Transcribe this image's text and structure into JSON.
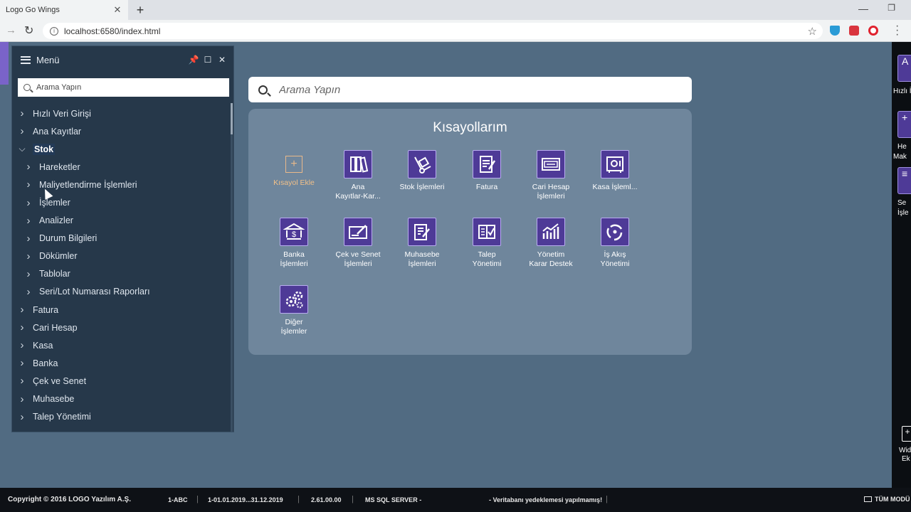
{
  "browser": {
    "tab_title": "Logo Go Wings",
    "url": "localhost:6580/index.html"
  },
  "menu": {
    "title": "Menü",
    "search_placeholder": "Arama Yapın",
    "items": [
      {
        "label": "Hızlı Veri Girişi",
        "level": 0,
        "expanded": false
      },
      {
        "label": "Ana Kayıtlar",
        "level": 0,
        "expanded": false
      },
      {
        "label": "Stok",
        "level": 0,
        "expanded": true,
        "active": true
      },
      {
        "label": "Hareketler",
        "level": 1,
        "expanded": false
      },
      {
        "label": "Maliyetlendirme İşlemleri",
        "level": 1,
        "expanded": false
      },
      {
        "label": "İşlemler",
        "level": 1,
        "expanded": false
      },
      {
        "label": "Analizler",
        "level": 1,
        "expanded": false
      },
      {
        "label": "Durum Bilgileri",
        "level": 1,
        "expanded": false
      },
      {
        "label": "Dökümler",
        "level": 1,
        "expanded": false
      },
      {
        "label": "Tablolar",
        "level": 1,
        "expanded": false
      },
      {
        "label": "Seri/Lot Numarası Raporları",
        "level": 1,
        "expanded": false
      },
      {
        "label": "Fatura",
        "level": 0,
        "expanded": false
      },
      {
        "label": "Cari Hesap",
        "level": 0,
        "expanded": false
      },
      {
        "label": "Kasa",
        "level": 0,
        "expanded": false
      },
      {
        "label": "Banka",
        "level": 0,
        "expanded": false
      },
      {
        "label": "Çek ve Senet",
        "level": 0,
        "expanded": false
      },
      {
        "label": "Muhasebe",
        "level": 0,
        "expanded": false
      },
      {
        "label": "Talep Yönetimi",
        "level": 0,
        "expanded": false
      }
    ]
  },
  "main": {
    "search_placeholder": "Arama Yapın",
    "panel_title": "Kısayollarım",
    "add_shortcut": {
      "label": "Kısayol Ekle"
    },
    "shortcuts": [
      {
        "line1": "Ana",
        "line2": "Kayıtlar-Kar...",
        "icon": "binders-icon"
      },
      {
        "line1": "Stok İşlemleri",
        "line2": "",
        "icon": "hand-truck-icon"
      },
      {
        "line1": "Fatura",
        "line2": "",
        "icon": "invoice-icon"
      },
      {
        "line1": "Cari Hesap",
        "line2": "İşlemleri",
        "icon": "account-card-icon"
      },
      {
        "line1": "Kasa İşleml...",
        "line2": "",
        "icon": "safe-icon"
      },
      {
        "line1": "Banka",
        "line2": "İşlemleri",
        "icon": "bank-icon"
      },
      {
        "line1": "Çek ve Senet",
        "line2": "İşlemleri",
        "icon": "check-icon"
      },
      {
        "line1": "Muhasebe",
        "line2": "İşlemleri",
        "icon": "ledger-icon"
      },
      {
        "line1": "Talep",
        "line2": "Yönetimi",
        "icon": "request-icon"
      },
      {
        "line1": "Yönetim",
        "line2": "Karar Destek",
        "icon": "growth-chart-icon"
      },
      {
        "line1": "İş Akış",
        "line2": "Yönetimi",
        "icon": "workflow-icon"
      },
      {
        "line1": "Diğer",
        "line2": "İşlemler",
        "icon": "gears-icon"
      }
    ]
  },
  "right_bar": {
    "tile1_label": "Hızlı İ",
    "tile2_label_a": "He",
    "tile2_label_b": "Mak",
    "tile3_label_a": "Se",
    "tile3_label_b": "İşle",
    "widget_a": "Wid",
    "widget_b": "Ek"
  },
  "status_bar": {
    "copyright": "Copyright © 2016 LOGO Yazılım A.Ş.",
    "company": "1-ABC",
    "period": "1-01.01.2019...31.12.2019",
    "version": "2.61.00.00",
    "db": "MS SQL SERVER -",
    "backup": "- Veritabanı yedeklemesi yapılmamış!",
    "modules": "TÜM MODÜ"
  },
  "colors": {
    "background": "#516b82",
    "menu_bg": "#26384a",
    "tile_purple": "#4e3a97",
    "add_accent": "#f1c089"
  }
}
